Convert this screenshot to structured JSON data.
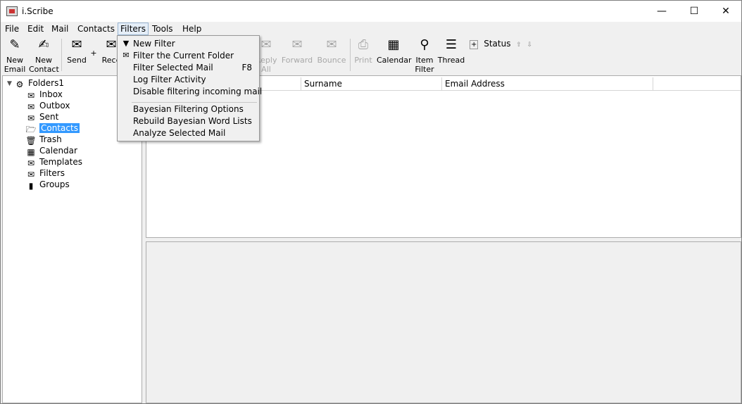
{
  "window": {
    "title": "i.Scribe",
    "minimize_glyph": "—",
    "maximize_glyph": "☐",
    "close_glyph": "✕"
  },
  "menubar": {
    "items": [
      "File",
      "Edit",
      "Mail",
      "Contacts",
      "Filters",
      "Tools",
      "Help"
    ],
    "active": "Filters"
  },
  "toolbar": {
    "new_email": [
      "New",
      "Email"
    ],
    "new_contact": [
      "New",
      "Contact"
    ],
    "send": "Send",
    "send_plus": "+",
    "receive": "Rece",
    "reply_all": [
      "Reply",
      "All"
    ],
    "forward": "Forward",
    "bounce": "Bounce",
    "print": "Print",
    "calendar": "Calendar",
    "item_filter": [
      "Item",
      "Filter"
    ],
    "thread": "Thread",
    "status_label": "Status",
    "status_expand": "+",
    "status_up": "⇧",
    "status_down": "⇩"
  },
  "tree": {
    "expander": "▼",
    "root": "Folders1",
    "items": [
      "Inbox",
      "Outbox",
      "Sent",
      "Contacts",
      "Trash",
      "Calendar",
      "Templates",
      "Filters",
      "Groups"
    ],
    "selected": "Contacts"
  },
  "list": {
    "columns": [
      "Surname",
      "Email Address"
    ]
  },
  "filters_menu": {
    "items": [
      {
        "label": "New Filter",
        "icon": "filter-funnel-icon"
      },
      {
        "label": "Filter the Current Folder",
        "icon": "filter-folder-icon"
      },
      {
        "label": "Filter Selected Mail",
        "shortcut": "F8"
      },
      {
        "label": "Log Filter Activity"
      },
      {
        "label": "Disable filtering incoming mail"
      },
      {
        "label": "Bayesian Filtering Options"
      },
      {
        "label": "Rebuild Bayesian Word Lists"
      },
      {
        "label": "Analyze Selected Mail"
      }
    ]
  },
  "colors": {
    "selection": "#3399ff",
    "menu_active_bg": "#e5eef8",
    "disabled_text": "#a8a8a8"
  }
}
